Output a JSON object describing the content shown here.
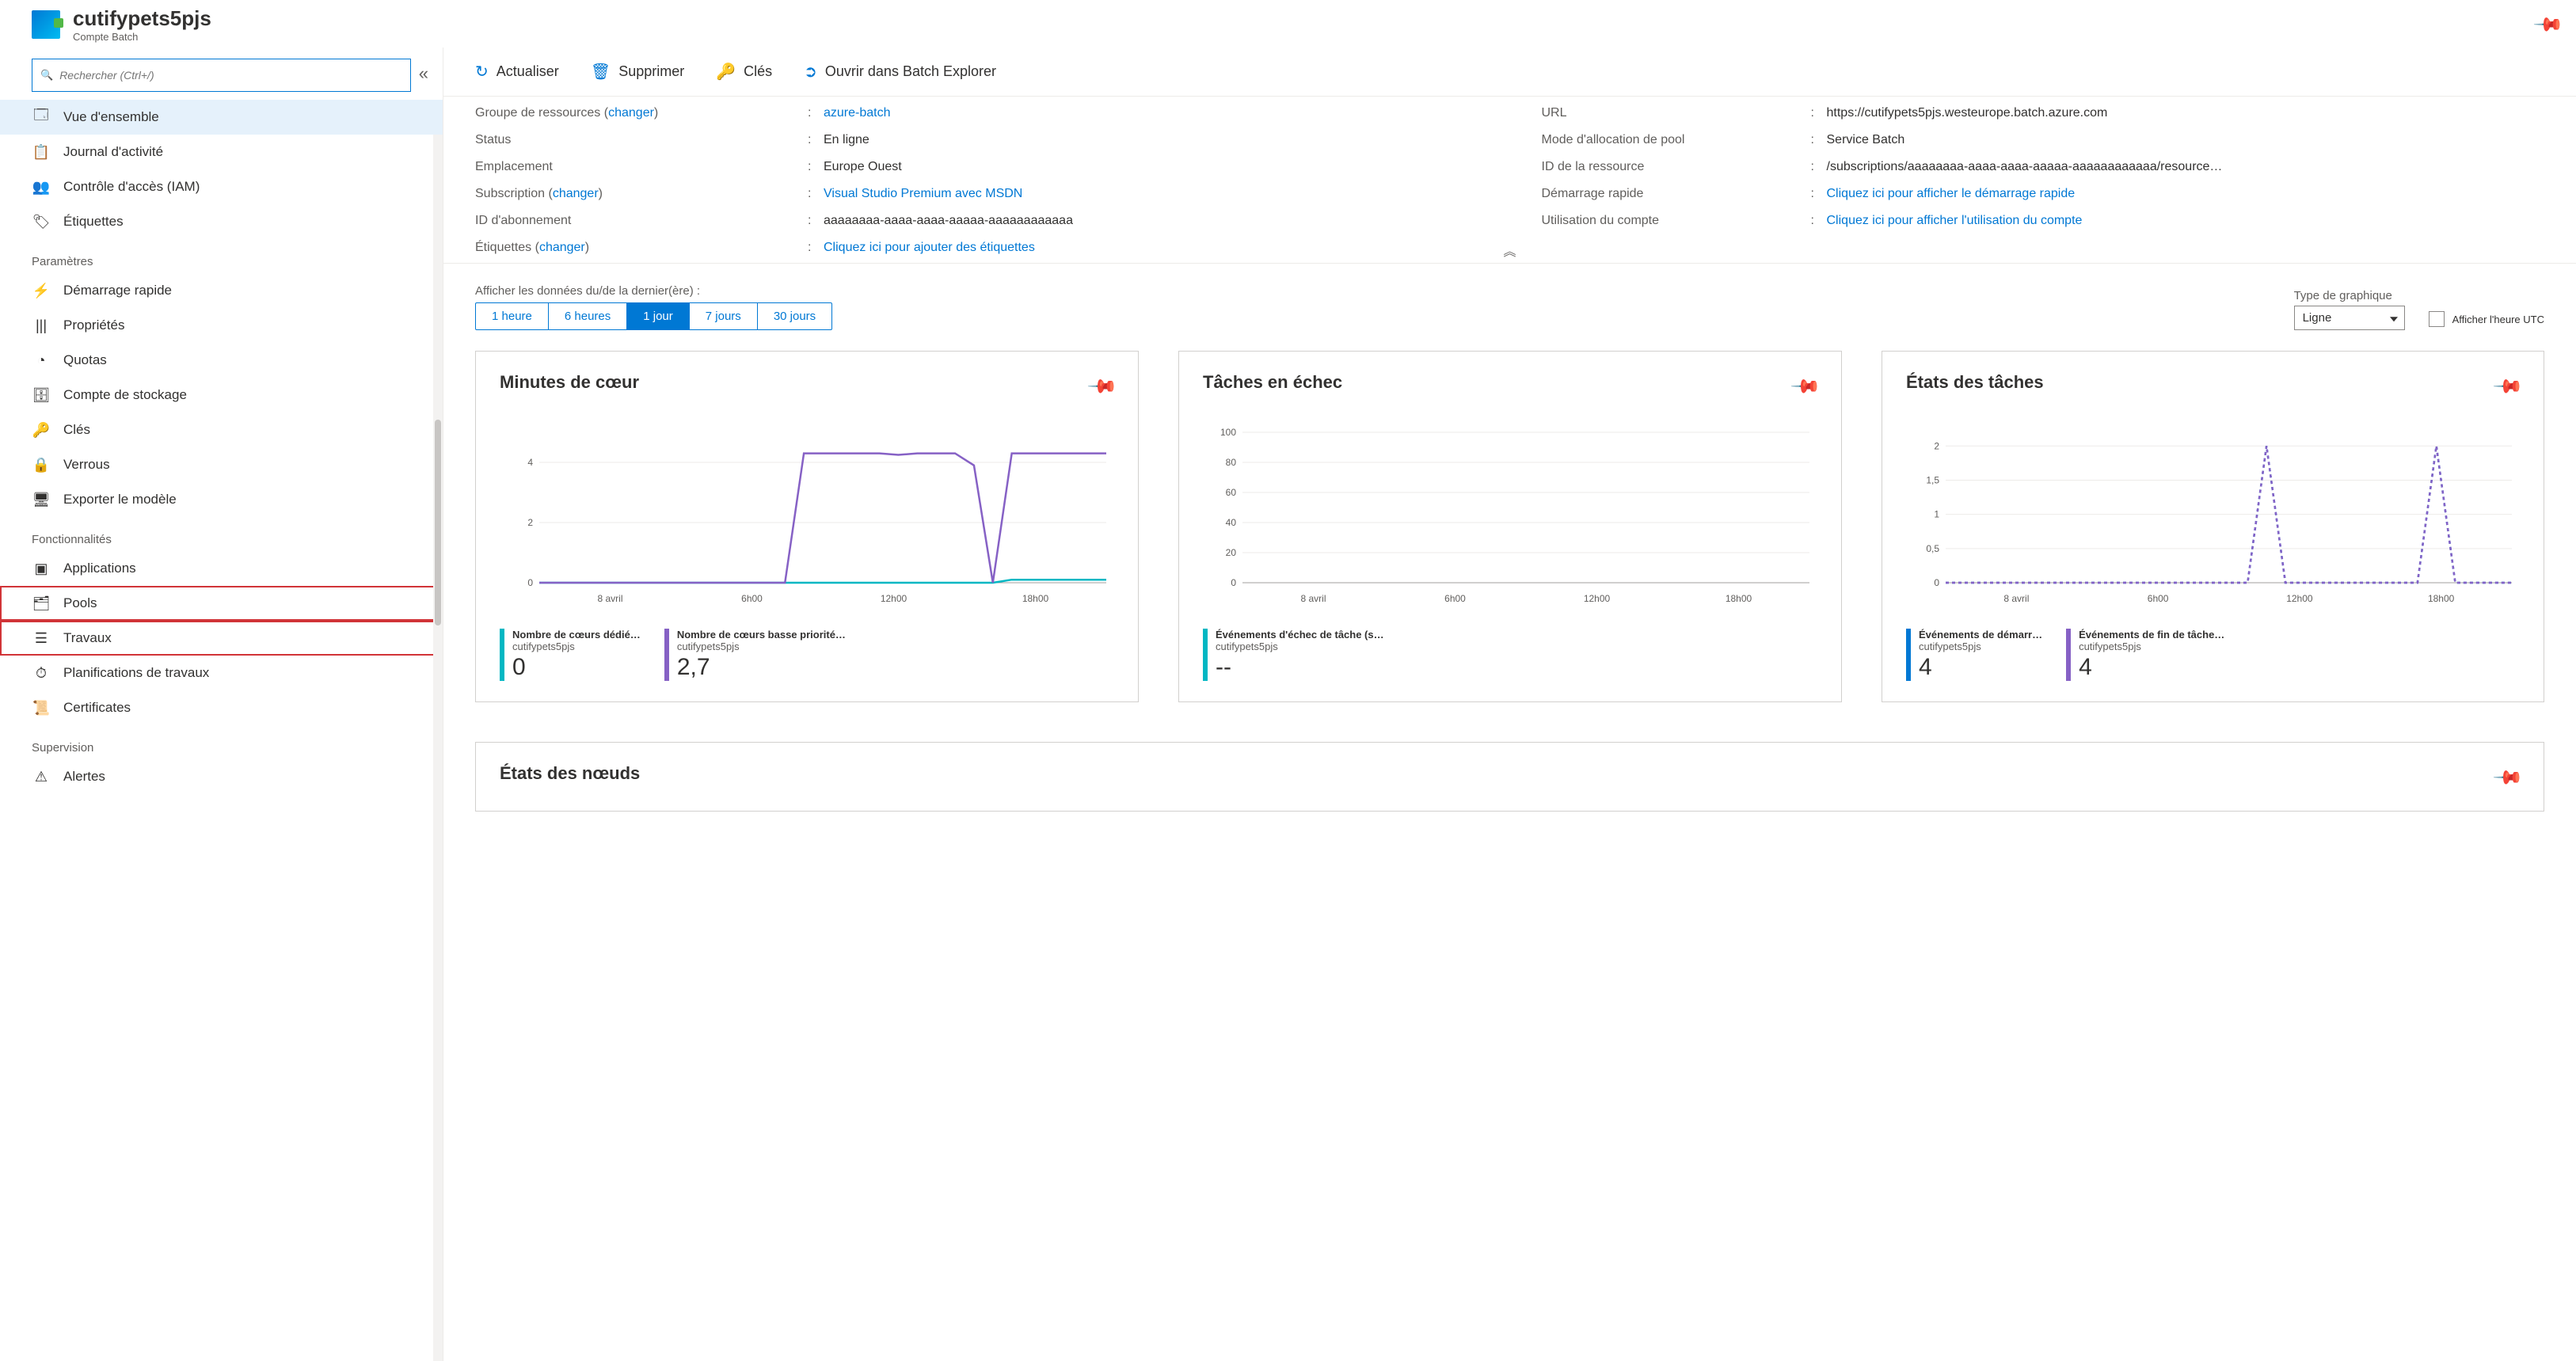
{
  "header": {
    "title": "cutifypets5pjs",
    "subtitle": "Compte Batch"
  },
  "sidebar": {
    "search_placeholder": "Rechercher (Ctrl+/)",
    "items_top": [
      {
        "icon": "overview",
        "label": "Vue d'ensemble",
        "active": true
      },
      {
        "icon": "activity",
        "label": "Journal d'activité"
      },
      {
        "icon": "iam",
        "label": "Contrôle d'accès (IAM)"
      },
      {
        "icon": "tag",
        "label": "Étiquettes"
      }
    ],
    "section_settings": "Paramètres",
    "items_settings": [
      {
        "icon": "quickstart",
        "label": "Démarrage rapide"
      },
      {
        "icon": "props",
        "label": "Propriétés"
      },
      {
        "icon": "quota",
        "label": "Quotas"
      },
      {
        "icon": "storage",
        "label": "Compte de stockage"
      },
      {
        "icon": "keys",
        "label": "Clés"
      },
      {
        "icon": "locks",
        "label": "Verrous"
      },
      {
        "icon": "export",
        "label": "Exporter le modèle"
      }
    ],
    "section_features": "Fonctionnalités",
    "items_features": [
      {
        "icon": "apps",
        "label": "Applications"
      },
      {
        "icon": "pools",
        "label": "Pools",
        "highlighted": true
      },
      {
        "icon": "jobs",
        "label": "Travaux",
        "highlighted": true
      },
      {
        "icon": "sched",
        "label": "Planifications de travaux"
      },
      {
        "icon": "certs",
        "label": "Certificates"
      }
    ],
    "section_supervision": "Supervision",
    "items_supervision": [
      {
        "icon": "alerts",
        "label": "Alertes"
      }
    ]
  },
  "toolbar": {
    "refresh": "Actualiser",
    "delete": "Supprimer",
    "keys": "Clés",
    "open": "Ouvrir dans Batch Explorer"
  },
  "essentials": {
    "rg_label": "Groupe de ressources",
    "change": "changer",
    "rg_value": "azure-batch",
    "status_label": "Status",
    "status_value": "En ligne",
    "location_label": "Emplacement",
    "location_value": "Europe Ouest",
    "sub_label": "Subscription",
    "sub_value": "Visual Studio Premium avec MSDN",
    "subid_label": "ID d'abonnement",
    "subid_value": "aaaaaaaa-aaaa-aaaa-aaaaa-aaaaaaaaaaaa",
    "tags_label": "Étiquettes",
    "tags_value": "Cliquez ici pour ajouter des étiquettes",
    "url_label": "URL",
    "url_value": "https://cutifypets5pjs.westeurope.batch.azure.com",
    "poolmode_label": "Mode d'allocation de pool",
    "poolmode_value": "Service Batch",
    "resid_label": "ID de la ressource",
    "resid_value": "/subscriptions/aaaaaaaa-aaaa-aaaa-aaaaa-aaaaaaaaaaaa/resource…",
    "quick_label": "Démarrage rapide",
    "quick_value": "Cliquez ici pour afficher le démarrage rapide",
    "usage_label": "Utilisation du compte",
    "usage_value": "Cliquez ici pour afficher l'utilisation du compte"
  },
  "dashboard": {
    "range_label": "Afficher les données du/de la dernier(ère) :",
    "ranges": [
      "1 heure",
      "6 heures",
      "1 jour",
      "7 jours",
      "30 jours"
    ],
    "range_selected": 2,
    "charttype_label": "Type de graphique",
    "charttype_value": "Ligne",
    "utc_label": "Afficher l'heure UTC"
  },
  "cards": {
    "c1": {
      "title": "Minutes de cœur",
      "legend": [
        {
          "color": "#00b7c3",
          "title": "Nombre de cœurs dédié…",
          "sub": "cutifypets5pjs",
          "value": "0"
        },
        {
          "color": "#8661c5",
          "title": "Nombre de cœurs basse priorité…",
          "sub": "cutifypets5pjs",
          "value": "2,7"
        }
      ]
    },
    "c2": {
      "title": "Tâches en échec",
      "legend": [
        {
          "color": "#00b7c3",
          "title": "Événements d'échec de tâche (somme)",
          "sub": "cutifypets5pjs",
          "value": "--"
        }
      ]
    },
    "c3": {
      "title": "États des tâches",
      "legend": [
        {
          "color": "#0078d4",
          "title": "Événements de démarr…",
          "sub": "cutifypets5pjs",
          "value": "4"
        },
        {
          "color": "#8661c5",
          "title": "Événements de fin de tâche…",
          "sub": "cutifypets5pjs",
          "value": "4"
        }
      ]
    },
    "c4": {
      "title": "États des nœuds"
    }
  },
  "chart_data": [
    {
      "type": "line",
      "title": "Minutes de cœur",
      "x_ticks": [
        "8 avril",
        "6h00",
        "12h00",
        "18h00"
      ],
      "y_ticks": [
        0,
        2,
        4
      ],
      "series": [
        {
          "name": "Nombre de cœurs dédié",
          "color": "#00b7c3",
          "values": [
            0,
            0,
            0,
            0,
            0,
            0,
            0,
            0,
            0,
            0,
            0,
            0,
            0,
            0,
            0,
            0,
            0,
            0,
            0,
            0,
            0,
            0,
            0,
            0,
            0,
            0.1,
            0.1,
            0.1,
            0.1,
            0.1,
            0.1
          ]
        },
        {
          "name": "Nombre de cœurs basse priorité",
          "color": "#8661c5",
          "values": [
            0,
            0,
            0,
            0,
            0,
            0,
            0,
            0,
            0,
            0,
            0,
            0,
            0,
            0,
            4.3,
            4.3,
            4.3,
            4.3,
            4.3,
            4.25,
            4.3,
            4.3,
            4.3,
            3.9,
            0,
            4.3,
            4.3,
            4.3,
            4.3,
            4.3,
            4.3
          ]
        }
      ],
      "ylim": [
        0,
        5
      ]
    },
    {
      "type": "line",
      "title": "Tâches en échec",
      "x_ticks": [
        "8 avril",
        "6h00",
        "12h00",
        "18h00"
      ],
      "y_ticks": [
        0,
        20,
        40,
        60,
        80,
        100
      ],
      "series": [],
      "ylim": [
        0,
        100
      ]
    },
    {
      "type": "line",
      "title": "États des tâches",
      "x_ticks": [
        "8 avril",
        "6h00",
        "12h00",
        "18h00"
      ],
      "y_ticks": [
        0,
        0.5,
        1,
        1.5,
        2
      ],
      "series": [
        {
          "name": "Événements de démarrage",
          "color": "#0078d4",
          "style": "dashed",
          "values": [
            0,
            0,
            0,
            0,
            0,
            0,
            0,
            0,
            0,
            0,
            0,
            0,
            0,
            0,
            0,
            0,
            0,
            2,
            0,
            0,
            0,
            0,
            0,
            0,
            0,
            0,
            2,
            0,
            0,
            0,
            0
          ]
        },
        {
          "name": "Événements de fin de tâche",
          "color": "#8661c5",
          "style": "dashed",
          "values": [
            0,
            0,
            0,
            0,
            0,
            0,
            0,
            0,
            0,
            0,
            0,
            0,
            0,
            0,
            0,
            0,
            0,
            2,
            0,
            0,
            0,
            0,
            0,
            0,
            0,
            0,
            2,
            0,
            0,
            0,
            0
          ]
        }
      ],
      "ylim": [
        0,
        2.2
      ]
    }
  ]
}
